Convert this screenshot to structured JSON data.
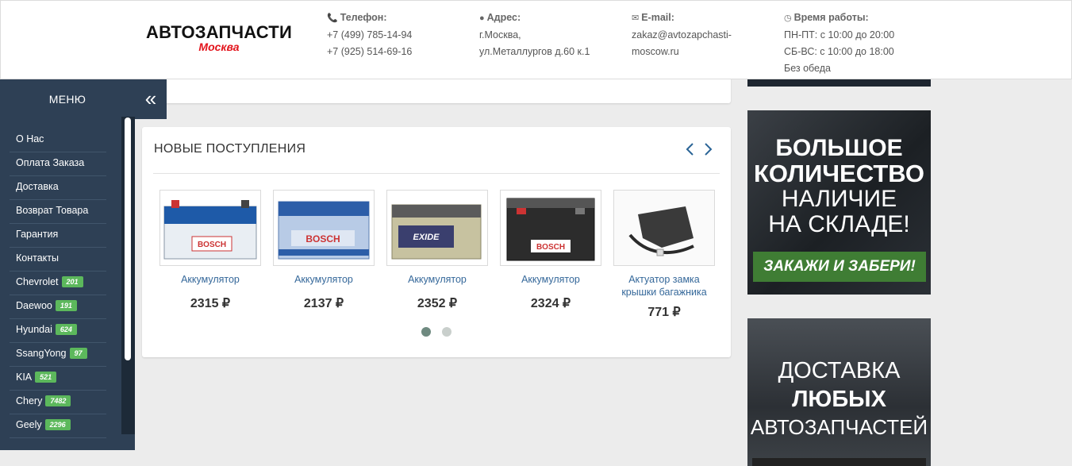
{
  "header": {
    "logo_main": "АВТОЗАПЧАСТИ",
    "logo_sub": "Москва",
    "phone": {
      "label": "Телефон:",
      "line1": "+7 (499) 785-14-94",
      "line2": "+7 (925) 514-69-16"
    },
    "address": {
      "label": "Адрес:",
      "line1": "г.Москва,",
      "line2": "ул.Металлургов д.60 к.1"
    },
    "email": {
      "label": "E-mail:",
      "line1": "zakaz@avtozapchasti-",
      "line2": "moscow.ru"
    },
    "hours": {
      "label": "Время работы:",
      "line1": "ПН-ПТ: с 10:00 до 20:00",
      "line2": "СБ-ВС: с 10:00 до 18:00",
      "line3": "Без обеда"
    }
  },
  "sidebar": {
    "title": "МЕНЮ",
    "toggle_icon": "«",
    "items": [
      {
        "label": "О Нас",
        "badge": ""
      },
      {
        "label": "Оплата Заказа",
        "badge": ""
      },
      {
        "label": "Доставка",
        "badge": ""
      },
      {
        "label": "Возврат Товара",
        "badge": ""
      },
      {
        "label": "Гарантия",
        "badge": ""
      },
      {
        "label": "Контакты",
        "badge": ""
      },
      {
        "label": "Chevrolet",
        "badge": "201"
      },
      {
        "label": "Daewoo",
        "badge": "191"
      },
      {
        "label": "Hyundai",
        "badge": "624"
      },
      {
        "label": "SsangYong",
        "badge": "97"
      },
      {
        "label": "KIA",
        "badge": "521"
      },
      {
        "label": "Chery",
        "badge": "7482"
      },
      {
        "label": "Geely",
        "badge": "2296"
      }
    ]
  },
  "new_arrivals": {
    "title": "НОВЫЕ ПОСТУПЛЕНИЯ",
    "prev_icon": "‹",
    "next_icon": "›",
    "products": [
      {
        "name": "Аккумулятор",
        "price": "2315 ₽",
        "brand": "BOSCH"
      },
      {
        "name": "Аккумулятор",
        "price": "2137 ₽",
        "brand": "BOSCH"
      },
      {
        "name": "Аккумулятор",
        "price": "2352 ₽",
        "brand": "EXIDE"
      },
      {
        "name": "Аккумулятор",
        "price": "2324 ₽",
        "brand": "BOSCH"
      },
      {
        "name": "Актуатор замка крышки багажника",
        "price": "771 ₽",
        "brand": ""
      }
    ]
  },
  "banners": {
    "stock": {
      "line1": "БОЛЬШОЕ",
      "line2": "КОЛИЧЕСТВО",
      "line3": "НАЛИЧИЕ",
      "line4": "НА СКЛАДЕ!",
      "cta": "ЗАКАЖИ И ЗАБЕРИ!"
    },
    "delivery": {
      "line1": "ДОСТАВКА",
      "line2": "ЛЮБЫХ",
      "line3": "АВТОЗАПЧАСТЕЙ"
    }
  },
  "colors": {
    "sidebar": "#2e4055",
    "badge": "#5cb85c",
    "link": "#35689a",
    "logo_accent": "#e3131b"
  }
}
